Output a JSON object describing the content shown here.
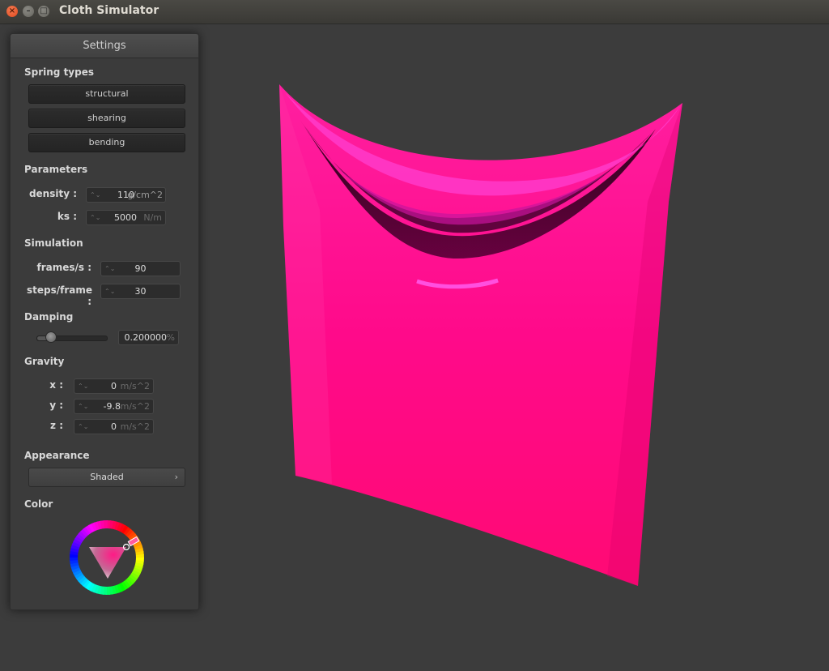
{
  "window": {
    "title": "Cloth Simulator",
    "close_glyph": "×",
    "min_glyph": "–",
    "max_glyph": "□"
  },
  "panel": {
    "header": "Settings",
    "spring_types": {
      "label": "Spring types",
      "buttons": [
        "structural",
        "shearing",
        "bending"
      ]
    },
    "parameters": {
      "label": "Parameters",
      "density": {
        "label": "density :",
        "value": "110",
        "unit": "g/cm^2"
      },
      "ks": {
        "label": "ks :",
        "value": "5000",
        "unit": "N/m"
      }
    },
    "simulation": {
      "label": "Simulation",
      "frames": {
        "label": "frames/s :",
        "value": "90"
      },
      "steps": {
        "label": "steps/frame :",
        "value": "30"
      }
    },
    "damping": {
      "label": "Damping",
      "level": 0.2,
      "value": "0.200000",
      "unit": "%"
    },
    "gravity": {
      "label": "Gravity",
      "x": {
        "label": "x :",
        "value": "0",
        "unit": "m/s^2"
      },
      "y": {
        "label": "y :",
        "value": "-9.8",
        "unit": "m/s^2"
      },
      "z": {
        "label": "z :",
        "value": "0",
        "unit": "m/s^2"
      }
    },
    "appearance": {
      "label": "Appearance",
      "selected": "Shaded",
      "chevron": "›"
    },
    "color": {
      "label": "Color",
      "selected_hex": "#ff0f80"
    }
  },
  "icons": {
    "spin_arrows": "⌃⌄",
    "close": "close-icon",
    "minimize": "minimize-icon",
    "maximize": "maximize-icon"
  }
}
